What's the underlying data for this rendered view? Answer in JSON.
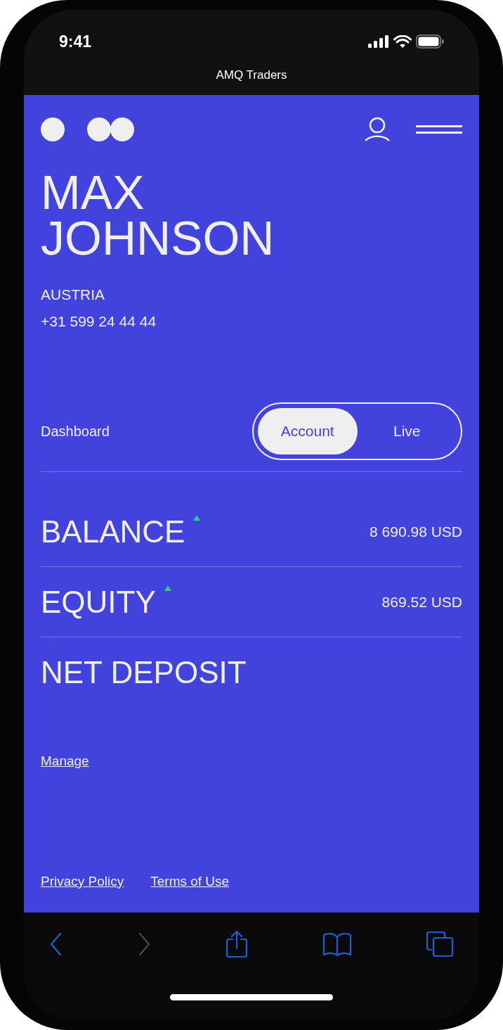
{
  "status_bar": {
    "time": "9:41"
  },
  "browser": {
    "title": "AMQ Traders",
    "back_enabled": true,
    "forward_enabled": false
  },
  "profile": {
    "name_lines": [
      "MAX",
      "JOHNSON"
    ],
    "country": "AUSTRIA",
    "phone": "+31 599 24 44 44"
  },
  "dashboard": {
    "label": "Dashboard",
    "tabs": [
      {
        "label": "Account",
        "selected": true
      },
      {
        "label": "Live",
        "selected": false
      }
    ]
  },
  "metrics": [
    {
      "label": "BALANCE",
      "rising": true,
      "value": "8 690.98 USD"
    },
    {
      "label": "EQUITY",
      "rising": true,
      "value": "869.52 USD"
    },
    {
      "label": "NET DEPOSIT",
      "rising": false
    }
  ],
  "manage_link": "Manage",
  "footer_links": [
    "Privacy Policy",
    "Terms of Use"
  ]
}
